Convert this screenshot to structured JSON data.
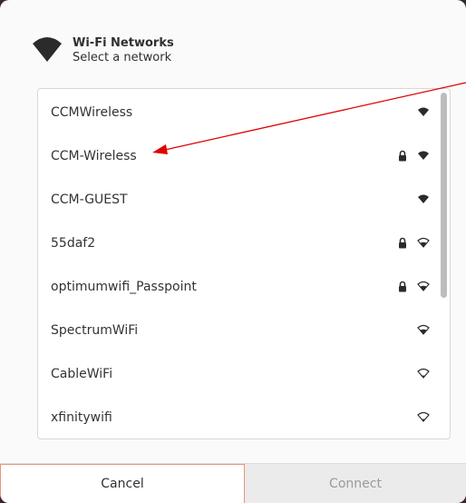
{
  "header": {
    "title": "Wi-Fi Networks",
    "subtitle": "Select a network",
    "icon": "wifi-icon"
  },
  "networks": [
    {
      "name": "CCMWireless",
      "secured": false,
      "signal": "strong"
    },
    {
      "name": "CCM-Wireless",
      "secured": true,
      "signal": "strong"
    },
    {
      "name": "CCM-GUEST",
      "secured": false,
      "signal": "strong"
    },
    {
      "name": "55daf2",
      "secured": true,
      "signal": "medium"
    },
    {
      "name": "optimumwifi_Passpoint",
      "secured": true,
      "signal": "medium"
    },
    {
      "name": "SpectrumWiFi",
      "secured": false,
      "signal": "medium"
    },
    {
      "name": "CableWiFi",
      "secured": false,
      "signal": "weak"
    },
    {
      "name": "xfinitywifi",
      "secured": false,
      "signal": "weak"
    }
  ],
  "buttons": {
    "cancel": "Cancel",
    "connect": "Connect"
  },
  "colors": {
    "annotation_arrow": "#e00000",
    "cancel_border": "#e9967a",
    "connect_disabled_text": "#9a9a9a"
  }
}
